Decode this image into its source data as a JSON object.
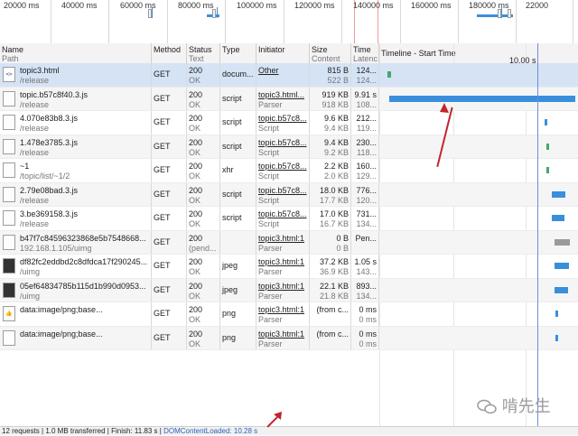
{
  "overview": {
    "ticks": [
      "20000 ms",
      "40000 ms",
      "60000 ms",
      "80000 ms",
      "100000 ms",
      "120000 ms",
      "140000 ms",
      "160000 ms",
      "180000 ms",
      "22000"
    ]
  },
  "columns": {
    "name": {
      "label": "Name",
      "sub": "Path"
    },
    "method": {
      "label": "Method"
    },
    "status": {
      "label": "Status",
      "sub": "Text"
    },
    "type": {
      "label": "Type"
    },
    "initiator": {
      "label": "Initiator"
    },
    "size": {
      "label": "Size",
      "sub": "Content"
    },
    "time": {
      "label": "Time",
      "sub": "Latenc"
    },
    "timeline": {
      "label": "Timeline - Start Time",
      "marker": "10.00 s"
    }
  },
  "rows": [
    {
      "name": "topic3.html",
      "path": "/release",
      "method": "GET",
      "status": "200",
      "text": "OK",
      "type": "docum...",
      "initiator": "Other",
      "initiator2": "",
      "size": "815 B",
      "content": "522 B",
      "time": "124...",
      "latency": "124...",
      "icon": "html-file-icon",
      "icon_glyph": "<>",
      "bar": {
        "start": 0.04,
        "end": 0.06,
        "color": "#45a86b"
      }
    },
    {
      "name": "topic.b57c8f40.3.js",
      "path": "/release",
      "method": "GET",
      "status": "200",
      "text": "OK",
      "type": "script",
      "initiator": "topic3.html...",
      "initiator2": "Parser",
      "size": "919 KB",
      "content": "918 KB",
      "time": "9.91 s",
      "latency": "108...",
      "icon": "script-file-icon",
      "icon_glyph": "",
      "bar": {
        "start": 0.05,
        "end": 0.985,
        "color": "#3a8fdc"
      }
    },
    {
      "name": "4.070e83b8.3.js",
      "path": "/release",
      "method": "GET",
      "status": "200",
      "text": "OK",
      "type": "script",
      "initiator": "topic.b57c8...",
      "initiator2": "Script",
      "size": "9.6 KB",
      "content": "9.4 KB",
      "time": "212...",
      "latency": "119...",
      "icon": "script-file-icon",
      "icon_glyph": "",
      "bar": {
        "start": 0.83,
        "end": 0.845,
        "color": "#3a8fdc"
      }
    },
    {
      "name": "1.478e3785.3.js",
      "path": "/release",
      "method": "GET",
      "status": "200",
      "text": "OK",
      "type": "script",
      "initiator": "topic.b57c8...",
      "initiator2": "Script",
      "size": "9.4 KB",
      "content": "9.2 KB",
      "time": "230...",
      "latency": "118...",
      "icon": "script-file-icon",
      "icon_glyph": "",
      "bar": {
        "start": 0.84,
        "end": 0.855,
        "color": "#45a86b"
      }
    },
    {
      "name": "~1",
      "path": "/topic/list/~1/2",
      "method": "GET",
      "status": "200",
      "text": "OK",
      "type": "xhr",
      "initiator": "topic.b57c8...",
      "initiator2": "Script",
      "size": "2.2 KB",
      "content": "2.0 KB",
      "time": "160...",
      "latency": "129...",
      "icon": "blank-file-icon",
      "icon_glyph": "",
      "bar": {
        "start": 0.84,
        "end": 0.855,
        "color": "#45a86b"
      }
    },
    {
      "name": "2.79e08bad.3.js",
      "path": "/release",
      "method": "GET",
      "status": "200",
      "text": "OK",
      "type": "script",
      "initiator": "topic.b57c8...",
      "initiator2": "Script",
      "size": "18.0 KB",
      "content": "17.7 KB",
      "time": "776...",
      "latency": "120...",
      "icon": "script-file-icon",
      "icon_glyph": "",
      "bar": {
        "start": 0.87,
        "end": 0.935,
        "color": "#3a8fdc"
      }
    },
    {
      "name": "3.be369158.3.js",
      "path": "/release",
      "method": "GET",
      "status": "200",
      "text": "OK",
      "type": "script",
      "initiator": "topic.b57c8...",
      "initiator2": "Script",
      "size": "17.0 KB",
      "content": "16.7 KB",
      "time": "731...",
      "latency": "134...",
      "icon": "script-file-icon",
      "icon_glyph": "",
      "bar": {
        "start": 0.87,
        "end": 0.93,
        "color": "#3a8fdc"
      }
    },
    {
      "name": "b47f7c84596323868e5b7548668...",
      "path": "192.168.1.105/uimg",
      "method": "GET",
      "status": "200",
      "text": "(pend...",
      "type": "",
      "initiator": "topic3.html:1",
      "initiator2": "Parser",
      "size": "0 B",
      "content": "0 B",
      "time": "Pen...",
      "latency": "",
      "icon": "blank-file-icon",
      "icon_glyph": "",
      "bar": {
        "start": 0.88,
        "end": 0.96,
        "color": "#9a9a9a"
      }
    },
    {
      "name": "df82fc2eddbd2c8dfdca17f290245...",
      "path": "/uimg",
      "method": "GET",
      "status": "200",
      "text": "OK",
      "type": "jpeg",
      "initiator": "topic3.html:1",
      "initiator2": "Parser",
      "size": "37.2 KB",
      "content": "36.9 KB",
      "time": "1.05 s",
      "latency": "143...",
      "icon": "image-thumbnail-icon",
      "icon_glyph": "",
      "bar": {
        "start": 0.88,
        "end": 0.955,
        "color": "#3a8fdc"
      }
    },
    {
      "name": "05ef64834785b115d1b990d0953...",
      "path": "/uimg",
      "method": "GET",
      "status": "200",
      "text": "OK",
      "type": "jpeg",
      "initiator": "topic3.html:1",
      "initiator2": "Parser",
      "size": "22.1 KB",
      "content": "21.8 KB",
      "time": "893...",
      "latency": "134...",
      "icon": "image-thumbnail-icon",
      "icon_glyph": "",
      "bar": {
        "start": 0.88,
        "end": 0.95,
        "color": "#3a8fdc"
      }
    },
    {
      "name": "data:image/png;base...",
      "path": "",
      "method": "GET",
      "status": "200",
      "text": "OK",
      "type": "png",
      "initiator": "topic3.html:1",
      "initiator2": "Parser",
      "size": "(from c...",
      "content": "",
      "time": "0 ms",
      "latency": "0 ms",
      "icon": "thumbs-up-icon",
      "icon_glyph": "👍",
      "bar": {
        "start": 0.885,
        "end": 0.893,
        "color": "#3a8fdc"
      }
    },
    {
      "name": "data:image/png;base...",
      "path": "",
      "method": "GET",
      "status": "200",
      "text": "OK",
      "type": "png",
      "initiator": "topic3.html:1",
      "initiator2": "Parser",
      "size": "(from c...",
      "content": "",
      "time": "0 ms",
      "latency": "0 ms",
      "icon": "comment-icon",
      "icon_glyph": "",
      "bar": {
        "start": 0.885,
        "end": 0.893,
        "color": "#3a8fdc"
      }
    }
  ],
  "status_bar": {
    "summary": "12 requests  |  1.0 MB transferred  |  Finish: 11.83 s  |  ",
    "dom_loaded": "DOMContentLoaded: 10.28 s"
  },
  "watermark": {
    "text": "啃先生"
  },
  "colors": {
    "accent": "#3a8fdc",
    "annotation": "#c0262d",
    "selected_row": "#d5e3f5"
  }
}
